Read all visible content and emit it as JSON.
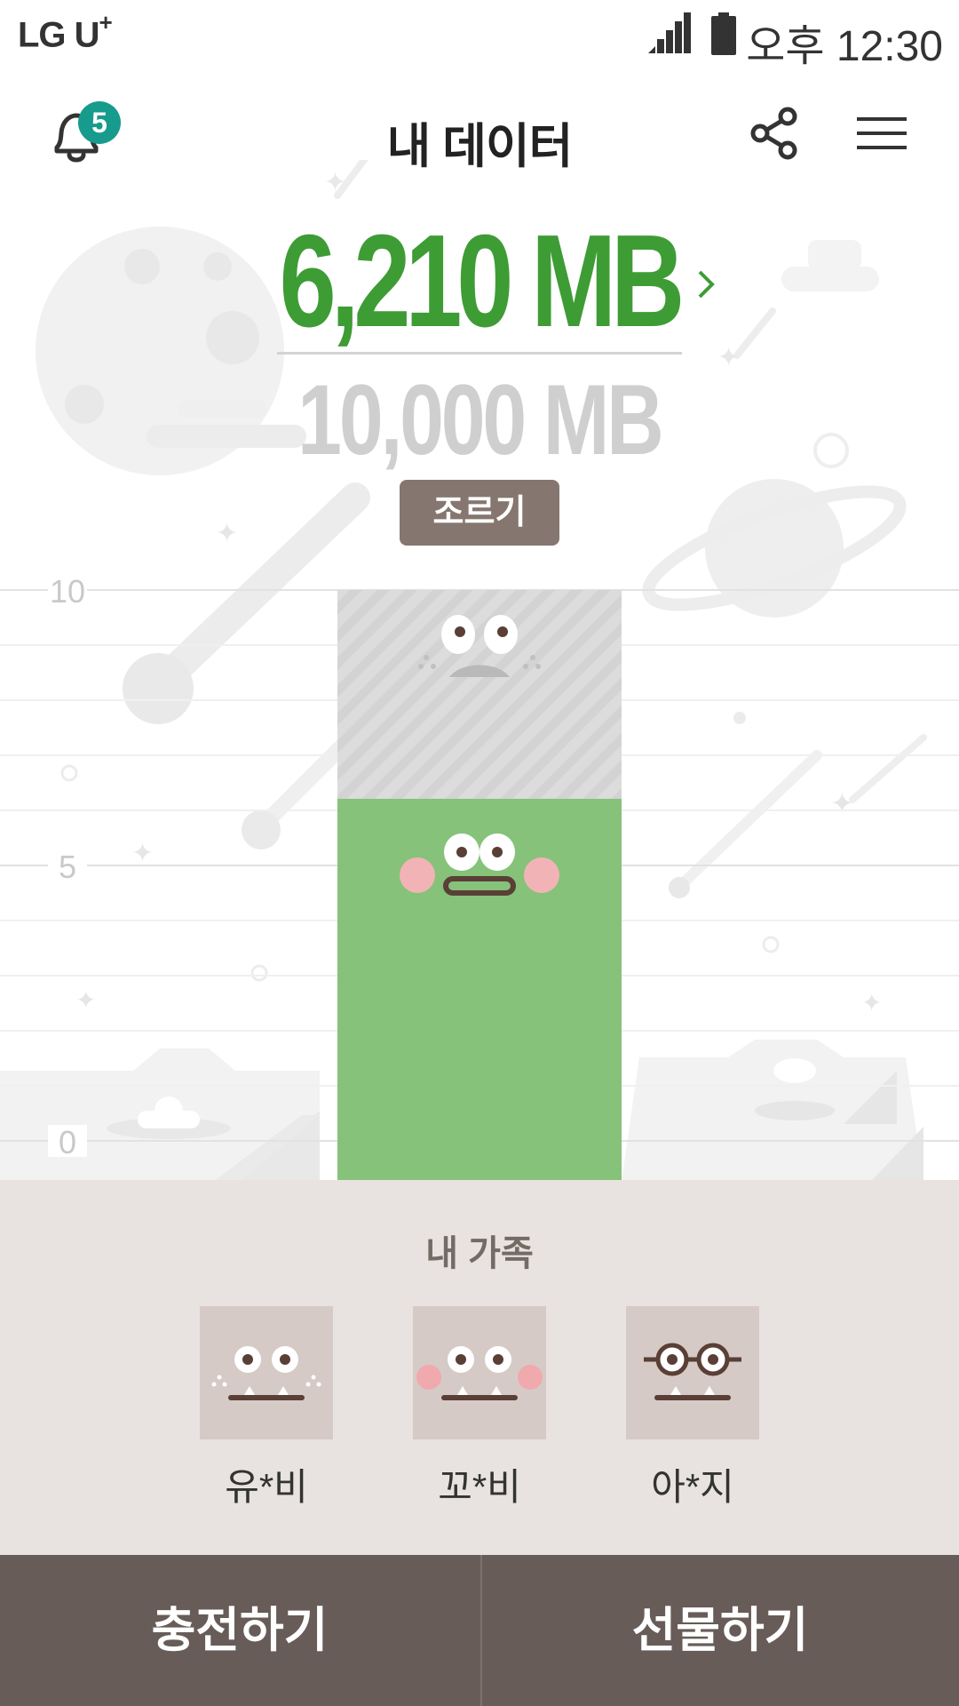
{
  "status_bar": {
    "carrier": "LG U",
    "carrier_plus": "+",
    "time": "오후 12:30"
  },
  "header": {
    "title": "내 데이터",
    "notification_count": "5"
  },
  "data_usage": {
    "used": "6,210 MB",
    "total": "10,000 MB",
    "used_mb": 6210,
    "total_mb": 10000,
    "beg_button": "조르기",
    "accent": "#3e9c35"
  },
  "chart_data": {
    "type": "bar",
    "y_ticks": [
      "10",
      "5",
      "0"
    ],
    "ylim": [
      0,
      10
    ],
    "series": [
      {
        "values": [
          6.21
        ],
        "color": "#86c27a"
      },
      {
        "values": [
          3.79
        ],
        "color": "#d9d9d9"
      }
    ]
  },
  "family": {
    "title": "내 가족",
    "members": [
      {
        "name": "유*비",
        "face": "plain-face-icon"
      },
      {
        "name": "꼬*비",
        "face": "blush-face-icon"
      },
      {
        "name": "아*지",
        "face": "glasses-face-icon"
      }
    ]
  },
  "actions": {
    "charge": "충전하기",
    "gift": "선물하기"
  }
}
